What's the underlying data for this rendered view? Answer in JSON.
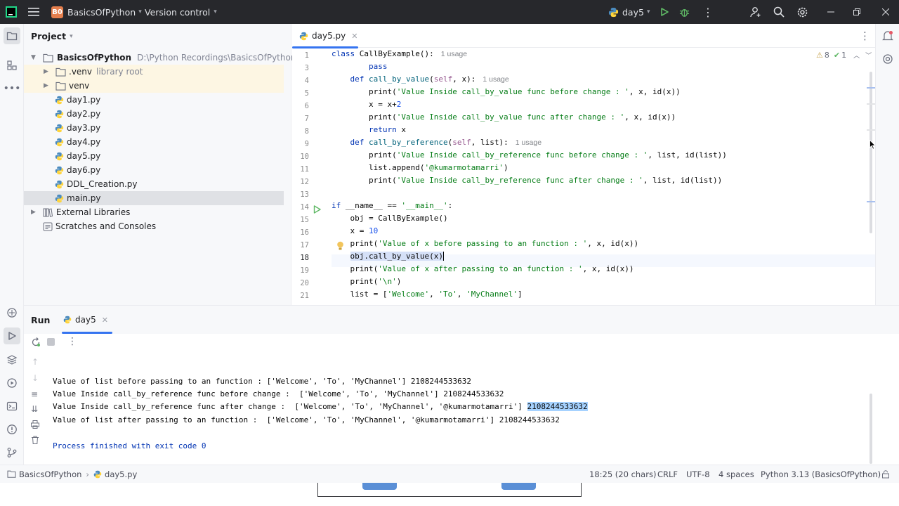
{
  "titlebar": {
    "project_badge": "B0",
    "project_name": "BasicsOfPython",
    "vcs": "Version control",
    "run_config": "day5"
  },
  "project_panel": {
    "title": "Project",
    "root": {
      "name": "BasicsOfPython",
      "path": "D:\\Python Recordings\\BasicsOfPython"
    },
    "items": [
      {
        "name": ".venv",
        "hint": "library root",
        "type": "folder"
      },
      {
        "name": "venv",
        "type": "folder"
      },
      {
        "name": "day1.py",
        "type": "py"
      },
      {
        "name": "day2.py",
        "type": "py"
      },
      {
        "name": "day3.py",
        "type": "py"
      },
      {
        "name": "day4.py",
        "type": "py"
      },
      {
        "name": "day5.py",
        "type": "py"
      },
      {
        "name": "day6.py",
        "type": "py"
      },
      {
        "name": "DDL_Creation.py",
        "type": "py"
      },
      {
        "name": "main.py",
        "type": "py"
      }
    ],
    "external_libraries": "External Libraries",
    "scratches": "Scratches and Consoles"
  },
  "editor": {
    "tab": "day5.py",
    "inspections": {
      "warnings": "8",
      "ok": "1"
    },
    "line_numbers": [
      "1",
      "3",
      "4",
      "5",
      "6",
      "7",
      "8",
      "9",
      "10",
      "11",
      "12",
      "13",
      "14",
      "15",
      "16",
      "17",
      "18",
      "19",
      "20",
      "21"
    ],
    "usage_1": "1 usage",
    "usage_4": "1 usage",
    "usage_9": "1 usage"
  },
  "run_panel": {
    "title": "Run",
    "tab": "day5",
    "output": [
      "Value of list before passing to an function : ['Welcome', 'To', 'MyChannel'] 2108244533632",
      "Value Inside call_by_reference func before change :  ['Welcome', 'To', 'MyChannel'] 2108244533632",
      "Value Inside call_by_reference func after change :  ['Welcome', 'To', 'MyChannel', '@kumarmotamarri'] ",
      "Value of list after passing to an function :  ['Welcome', 'To', 'MyChannel', '@kumarmotamarri'] 2108244533632",
      "Process finished with exit code 0"
    ],
    "highlighted_id": "2108244533632"
  },
  "statusbar": {
    "breadcrumb_project": "BasicsOfPython",
    "breadcrumb_file": "day5.py",
    "position": "18:25 (20 chars)",
    "line_sep": "CRLF",
    "encoding": "UTF-8",
    "indent": "4 spaces",
    "interpreter": "Python 3.13 (BasicsOfPython)"
  },
  "colors": {
    "accent": "#3574f0",
    "titlebar": "#27282c",
    "badge": "#e57f4d"
  }
}
